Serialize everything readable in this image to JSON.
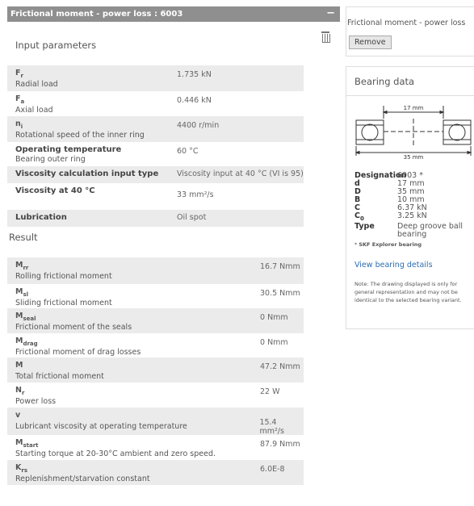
{
  "window": {
    "title": "Frictional moment - power loss : 6003",
    "collapse": "−"
  },
  "inputs": {
    "heading": "Input parameters",
    "rows": [
      {
        "sym": "F",
        "sub": "r",
        "desc": "Radial load",
        "value": "1.735 kN"
      },
      {
        "sym": "F",
        "sub": "a",
        "desc": "Axial load",
        "value": "0.446 kN"
      },
      {
        "sym": "n",
        "sub": "i",
        "desc": "Rotational speed of the inner ring",
        "value": "4400 r/min"
      },
      {
        "sym": "Operating temperature",
        "sub": "",
        "desc": "Bearing outer ring",
        "value": "60 °C"
      },
      {
        "sym": "Viscosity calculation input type",
        "sub": "",
        "desc": "",
        "value": "Viscosity input at 40 °C (VI is 95)"
      },
      {
        "sym": "Viscosity at 40 °C",
        "sub": "",
        "desc": "",
        "value": "33 mm²/s"
      },
      {
        "sym": "Lubrication",
        "sub": "",
        "desc": "",
        "value": "Oil spot"
      }
    ]
  },
  "results": {
    "heading": "Result",
    "rows": [
      {
        "sym": "M",
        "sub": "rr",
        "desc": "Rolling frictional moment",
        "value": "16.7 Nmm"
      },
      {
        "sym": "M",
        "sub": "sl",
        "desc": "Sliding frictional moment",
        "value": "30.5 Nmm"
      },
      {
        "sym": "M",
        "sub": "seal",
        "desc": "Frictional moment of the seals",
        "value": "0 Nmm"
      },
      {
        "sym": "M",
        "sub": "drag",
        "desc": "Frictional moment of drag losses",
        "value": "0 Nmm"
      },
      {
        "sym": "M",
        "sub": "",
        "desc": "Total frictional moment",
        "value": "47.2 Nmm"
      },
      {
        "sym": "N",
        "sub": "r",
        "desc": "Power loss",
        "value": "22 W"
      },
      {
        "sym": "v",
        "sub": "",
        "desc": "Lubricant viscosity at operating temperature",
        "value": "15.4 mm²/s"
      },
      {
        "sym": "M",
        "sub": "start",
        "desc": "Starting torque at 20-30°C ambient and zero speed.",
        "value": "87.9 Nmm"
      },
      {
        "sym": "K",
        "sub": "rs",
        "desc": "Replenishment/starvation constant",
        "value": "6.0E-8"
      }
    ]
  },
  "sidebar": {
    "calc_title": "Frictional moment - power loss",
    "remove_label": "Remove",
    "bearing_heading": "Bearing data",
    "dim_inner": "17 mm",
    "dim_outer": "35 mm",
    "specs": [
      {
        "key": "Designation",
        "sub": "",
        "value": "6003 *"
      },
      {
        "key": "d",
        "sub": "",
        "value": "17 mm"
      },
      {
        "key": "D",
        "sub": "",
        "value": "35 mm"
      },
      {
        "key": "B",
        "sub": "",
        "value": "10 mm"
      },
      {
        "key": "C",
        "sub": "",
        "value": "6.37 kN"
      },
      {
        "key": "C",
        "sub": "0",
        "value": "3.25 kN"
      },
      {
        "key": "Type",
        "sub": "",
        "value": "Deep groove ball bearing"
      }
    ],
    "explorer_mark": "* ",
    "explorer_text": "SKF Explorer bearing",
    "details_link": "View bearing details",
    "note": "Note: The drawing displayed is only for general representation and may not be identical to the selected bearing variant."
  }
}
